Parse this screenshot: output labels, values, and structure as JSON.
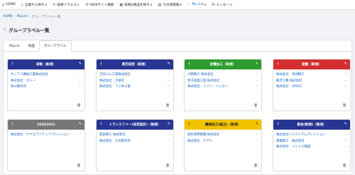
{
  "nav": [
    {
      "icon": "⌂",
      "label": "HOME",
      "caret": false
    },
    {
      "icon": "⌕",
      "label": "企業から探す",
      "caret": true
    },
    {
      "icon": "✎",
      "label": "技術リクエスト",
      "caret": false
    },
    {
      "icon": "✉",
      "label": "WEBサイト検索",
      "caret": false
    },
    {
      "icon": "▦",
      "label": "技術&製品を探す",
      "caret": true
    },
    {
      "icon": "▤",
      "label": "その他情報",
      "caret": true
    },
    {
      "icon": "♡",
      "label": "My List",
      "caret": true
    },
    {
      "icon": "✉",
      "label": "メッセージ",
      "caret": false
    }
  ],
  "breadcrumb": {
    "home": "HOME",
    "mylist": "MyList",
    "current": "グループラベル一覧"
  },
  "page_title": "グループラベル一覧",
  "tabs": [
    "MyList",
    "地図",
    "グループラベル"
  ],
  "active_tab": 2,
  "colors": {
    "navy": "#283593",
    "green": "#2e9c2e",
    "red": "#d32f2f",
    "gray": "#777777",
    "yellow": "#f2c200",
    "link": "#1565c0"
  },
  "cards": [
    {
      "title": "研削（新規）",
      "color": "#283593",
      "dark": false,
      "items": [
        "サノアス機械工業株式会社",
        "株式会社　カトー",
        "秋山製作所"
      ]
    },
    {
      "title": "真空成型（新規）",
      "color": "#283593",
      "dark": false,
      "items": [
        "吉岡ゴム工業株式会社",
        "株式会社　大研社",
        "株式会社　フジ木工業"
      ]
    },
    {
      "title": "放電加工（新規）",
      "color": "#2e9c2e",
      "dark": false,
      "items": [
        "大野精工 株式会社",
        "金子産業工業 株式会社",
        "株式会社　リバン・インカリ"
      ]
    },
    {
      "title": "旋盤（新規）",
      "color": "#d32f2f",
      "dark": false,
      "items": [
        "株式会社　金岡精工",
        "藤沢工機 株式会社",
        "株式会社　SPEEG"
      ]
    },
    {
      "title": "20241022",
      "color": "#777777",
      "dark": false,
      "items": [
        "株式会社　ヤナカアドテックプレシジョン"
      ]
    },
    {
      "title": "トランスファー(金型設計)（新規）",
      "color": "#283593",
      "dark": false,
      "items": [
        "型研精工 株式会社",
        "株式会社　三光製作所"
      ]
    },
    {
      "title": "機械加工(組立)（新規）",
      "color": "#f2c200",
      "dark": true,
      "items": [
        "旭村金野製機 株式会社",
        "株式会社　ヤマト"
      ]
    },
    {
      "title": "板金(新規)（東海）",
      "color": "#283593",
      "dark": false,
      "items": [
        "株式会社シイストテムプレシジョン",
        "東賀精工　株式会社",
        "株式会社　イシトメ精器"
      ]
    }
  ]
}
